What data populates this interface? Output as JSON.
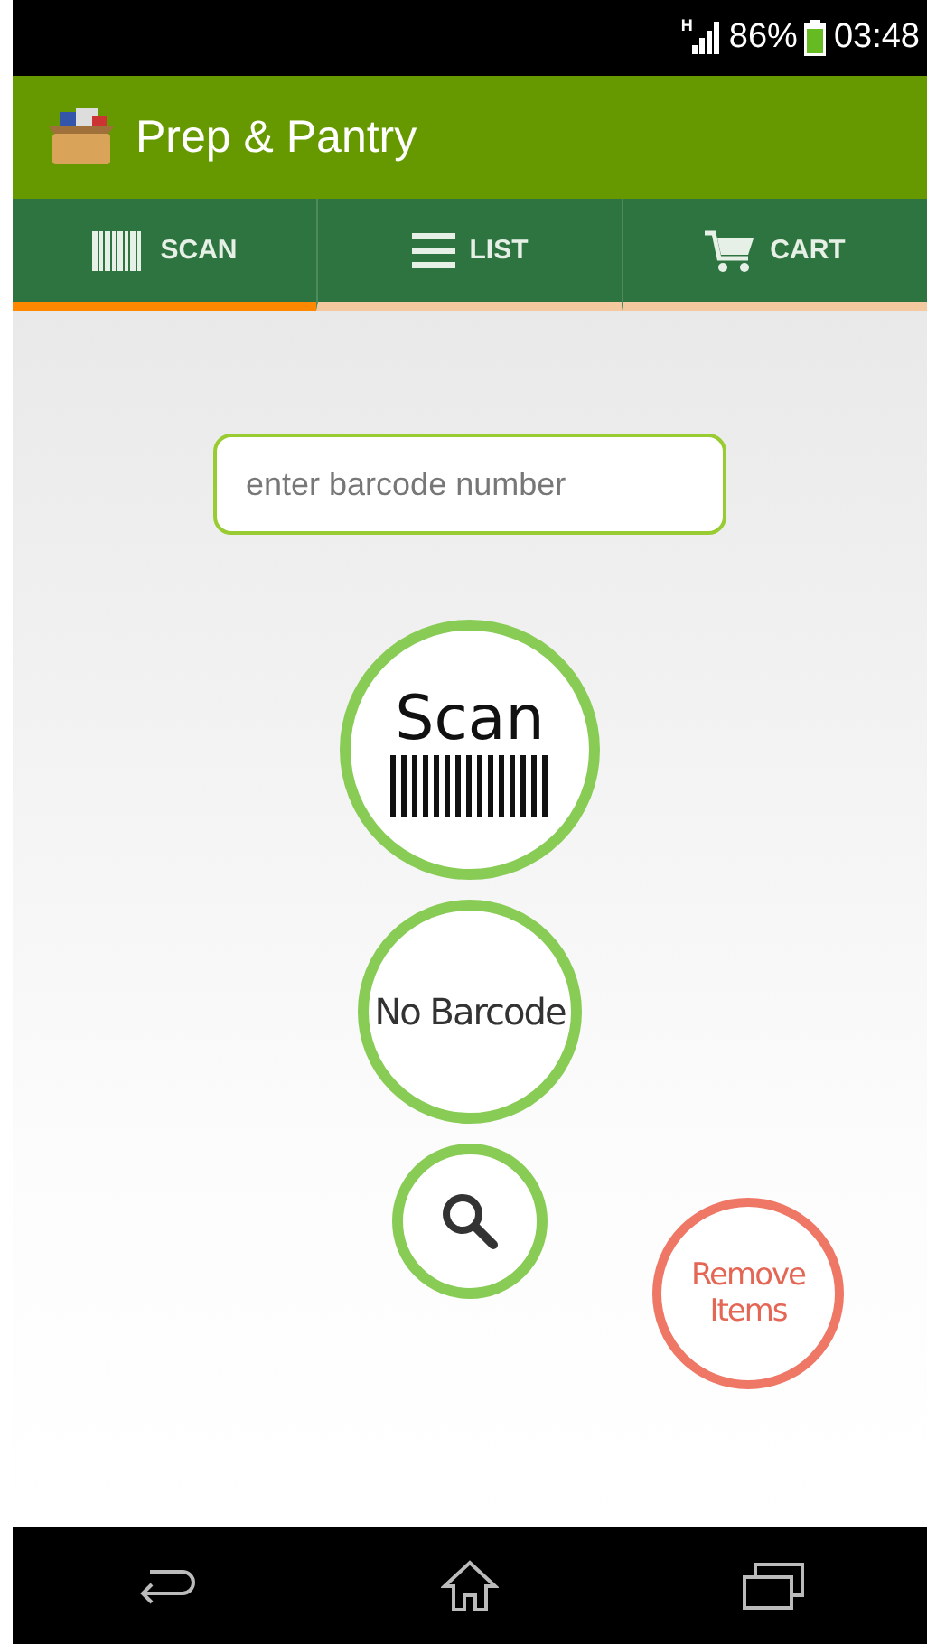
{
  "status_bar": {
    "network": "H",
    "battery": "86%",
    "time": "03:48"
  },
  "app_bar": {
    "title": "Prep & Pantry"
  },
  "tabs": [
    {
      "label": "SCAN",
      "kind": "barcode",
      "selected": true
    },
    {
      "label": "LIST",
      "kind": "list",
      "selected": false
    },
    {
      "label": "CART",
      "kind": "cart",
      "selected": false
    }
  ],
  "barcode_field": {
    "placeholder": "enter barcode number"
  },
  "actions": [
    {
      "kind": "scan",
      "label": "Scan"
    },
    {
      "kind": "text",
      "label": "No Barcode"
    },
    {
      "kind": "search"
    }
  ],
  "remove_button": {
    "label": "Remove Items"
  }
}
